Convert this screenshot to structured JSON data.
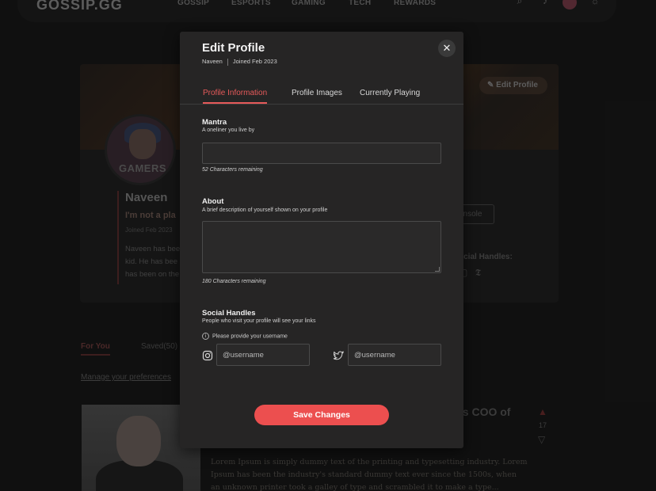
{
  "header": {
    "logo": "GOSSIP.GG",
    "nav": [
      "GOSSIP",
      "ESPORTS",
      "GAMING",
      "TECH",
      "REWARDS"
    ]
  },
  "profile_bg": {
    "edit_button": "Edit Profile",
    "avatar_text": "GAMERS",
    "name": "Naveen",
    "mantra": "I'm not a pla",
    "joined": "Joined Feb 2023",
    "bio_lines": [
      "Naveen has bee",
      "kid. He has bee",
      "has been on the"
    ],
    "console_button": "ensole",
    "social_handles_label": "ocial Handles:"
  },
  "feed_bg": {
    "tabs": [
      "For You",
      "Saved(50)"
    ],
    "manage_link": "Manage your preferences",
    "article_title": "as COO of",
    "votes": "17",
    "article_text": "Lorem Ipsum is simply dummy text of the printing and typesetting industry. Lorem Ipsum has been the industry's standard dummy text ever since the 1500s, when an unknown printer took a galley of type and scrambled it to make a type..."
  },
  "modal": {
    "title": "Edit Profile",
    "username": "Naveen",
    "joined": "Joined Feb 2023",
    "close_symbol": "✕",
    "tabs": [
      {
        "label": "Profile Information",
        "active": true
      },
      {
        "label": "Profile Images",
        "active": false
      },
      {
        "label": "Currently Playing",
        "active": false
      }
    ],
    "mantra": {
      "label": "Mantra",
      "description": "A oneliner you live by",
      "value": "",
      "remaining": "52 Characters remaining"
    },
    "about": {
      "label": "About",
      "description": "A brief description of yourself shown on your profile",
      "value": "",
      "remaining": "180 Characters remaining"
    },
    "social": {
      "label": "Social Handles",
      "description": "People who visit your profile will see your links",
      "hint": "Please provide your username",
      "instagram_placeholder": "@username",
      "twitter_placeholder": "@username"
    },
    "save_label": "Save Changes"
  },
  "colors": {
    "accent": "#ec4f4f",
    "tab_active": "#e65a5a",
    "modal_bg": "#262525"
  }
}
